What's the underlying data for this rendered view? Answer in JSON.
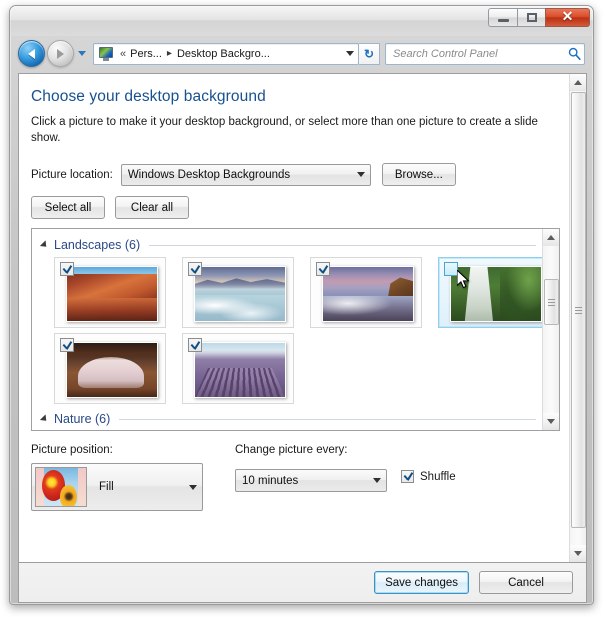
{
  "window": {
    "caption_buttons": {
      "minimize": "Minimize",
      "maximize": "Maximize",
      "close": "✕"
    }
  },
  "nav": {
    "back_label": "Back",
    "forward_label": "Forward",
    "recent_label": "Recent pages",
    "address_icon": "display-icon",
    "breadcrumb": {
      "overflow": "«",
      "items": [
        "Pers...",
        "Desktop Backgro..."
      ],
      "separator": "▸"
    },
    "refresh_label": "↻",
    "dropdown_label": "▾"
  },
  "search": {
    "placeholder": "Search Control Panel",
    "value": ""
  },
  "main": {
    "title": "Choose your desktop background",
    "description": "Click a picture to make it your desktop background, or select more than one picture to create a slide show.",
    "picture_location": {
      "label": "Picture location:",
      "value": "Windows Desktop Backgrounds",
      "browse_label": "Browse..."
    },
    "select_all_label": "Select all",
    "clear_all_label": "Clear all",
    "groups": [
      {
        "label": "Landscapes (6)",
        "expanded": true
      },
      {
        "label": "Nature (6)",
        "expanded": true
      }
    ],
    "thumbnails": [
      {
        "name": "canyon-reflection",
        "scene": "sc-canyon",
        "checked": true,
        "selected": false,
        "hover": false
      },
      {
        "name": "glacier-lake",
        "scene": "sc-lake",
        "checked": true,
        "selected": false,
        "hover": false
      },
      {
        "name": "purple-coastline",
        "scene": "sc-coast",
        "checked": true,
        "selected": false,
        "hover": false
      },
      {
        "name": "waterfall",
        "scene": "sc-falls",
        "checked": false,
        "selected": true,
        "hover": true
      },
      {
        "name": "mesa-arch",
        "scene": "sc-arch",
        "checked": true,
        "selected": false,
        "hover": false
      },
      {
        "name": "lavender-field",
        "scene": "sc-lavender",
        "checked": true,
        "selected": false,
        "hover": false
      }
    ],
    "picture_position": {
      "label": "Picture position:",
      "value": "Fill"
    },
    "change_picture": {
      "label": "Change picture every:",
      "value": "10 minutes"
    },
    "shuffle": {
      "label": "Shuffle",
      "checked": true
    }
  },
  "footer": {
    "save_label": "Save changes",
    "cancel_label": "Cancel"
  },
  "colors": {
    "title_blue": "#17518f",
    "group_blue": "#2a4a87",
    "default_button_border": "#3c91c4",
    "close_button_red": "#d94f2c"
  }
}
